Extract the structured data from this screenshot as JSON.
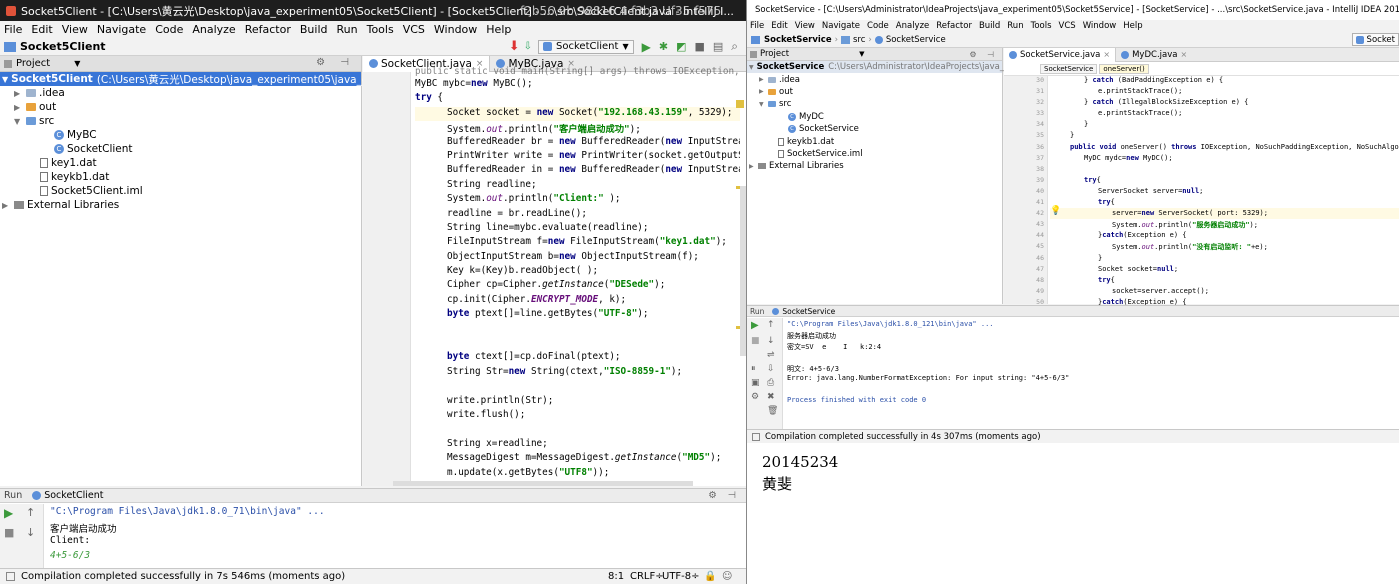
{
  "left": {
    "title": "Socket5Client - [C:\\Users\\黄云光\\Desktop\\java_experiment05\\Socket5Client] - [Socket5Client] - ...\\src\\SocketClient.java - IntelliJ I...",
    "menu": [
      "File",
      "Edit",
      "View",
      "Navigate",
      "Code",
      "Analyze",
      "Refactor",
      "Build",
      "Run",
      "Tools",
      "VCS",
      "Window",
      "Help"
    ],
    "breadcrumb": "Socket5Client",
    "run_config": "SocketClient",
    "overlay_text": "f2b56 9b 98816 4 f3b3 Uf35 f575",
    "project_panel": "Project",
    "tree": [
      {
        "label": "Socket5Client",
        "path": "(C:\\Users\\黄云光\\Desktop\\java_experiment05\\java_experiment",
        "icon": "module"
      },
      {
        "label": ".idea",
        "icon": "folder"
      },
      {
        "label": "out",
        "icon": "folder-orange"
      },
      {
        "label": "src",
        "icon": "folder-blue"
      },
      {
        "label": "MyBC",
        "icon": "class"
      },
      {
        "label": "SocketClient",
        "icon": "class"
      },
      {
        "label": "key1.dat",
        "icon": "file"
      },
      {
        "label": "keykb1.dat",
        "icon": "file"
      },
      {
        "label": "Socket5Client.iml",
        "icon": "file"
      },
      {
        "label": "External Libraries",
        "icon": "lib"
      }
    ],
    "tabs": [
      "SocketClient.java",
      "MyBC.java"
    ],
    "code_top": "public static void main(String[] args) throws IOException, ClassNot",
    "code": [
      "MyBC mybc=new MyBC();",
      "try {",
      "Socket socket = new Socket(\"192.168.43.159\", 5329);",
      "System.out.println(\"客户端启动成功\");",
      "BufferedReader br = new BufferedReader(new InputStreamReader(Sys",
      "PrintWriter write = new PrintWriter(socket.getOutputStream());",
      "BufferedReader in = new BufferedReader(new InputStreamReader(soc",
      "String readline;",
      "System.out.println(\"Client:\" );",
      "readline = br.readLine();",
      "String line=mybc.evaluate(readline);",
      "FileInputStream f=new FileInputStream(\"key1.dat\");",
      "ObjectInputStream b=new ObjectInputStream(f);",
      "Key k=(Key)b.readObject( );",
      "Cipher cp=Cipher.getInstance(\"DESede\");",
      "cp.init(Cipher.ENCRYPT_MODE, k);",
      "byte ptext[]=line.getBytes(\"UTF-8\");",
      "",
      "",
      "byte ctext[]=cp.doFinal(ptext);",
      "String Str=new String(ctext,\"ISO-8859-1\");",
      "",
      "write.println(Str);",
      "write.flush();",
      "",
      "String x=readline;",
      "MessageDigest m=MessageDigest.getInstance(\"MD5\");",
      "m.update(x.getBytes(\"UTF8\"));"
    ],
    "run_label": "Run",
    "run_tab": "SocketClient",
    "console": [
      "\"C:\\Program Files\\Java\\jdk1.8.0_71\\bin\\java\" ...",
      "客户端启动成功",
      "Client:",
      "4+5-6/3"
    ],
    "status": "Compilation completed successfully in 7s 546ms (moments ago)",
    "status_pos": "8:1",
    "status_crlf": "CRLF÷",
    "status_enc": "UTF-8÷"
  },
  "right": {
    "title": "SocketService - [C:\\Users\\Administrator\\IdeaProjects\\java_experiment05\\Socket5Service] - [SocketService] - ...\\src\\SocketService.java - IntelliJ IDEA 2017.1",
    "menu": [
      "File",
      "Edit",
      "View",
      "Navigate",
      "Code",
      "Analyze",
      "Refactor",
      "Build",
      "Run",
      "Tools",
      "VCS",
      "Window",
      "Help"
    ],
    "breadcrumb": [
      "SocketService",
      "src",
      "SocketService"
    ],
    "run_config": "Socket",
    "project_panel": "Project",
    "tree": [
      {
        "label": "SocketService",
        "path": "C:\\Users\\Administrator\\IdeaProjects\\java_experiment",
        "icon": "module"
      },
      {
        "label": ".idea",
        "icon": "folder"
      },
      {
        "label": "out",
        "icon": "folder-orange"
      },
      {
        "label": "src",
        "icon": "folder-blue"
      },
      {
        "label": "MyDC",
        "icon": "class"
      },
      {
        "label": "SocketService",
        "icon": "class"
      },
      {
        "label": "keykb1.dat",
        "icon": "file"
      },
      {
        "label": "SocketService.iml",
        "icon": "file"
      },
      {
        "label": "External Libraries",
        "icon": "lib"
      }
    ],
    "tabs": [
      "SocketService.java",
      "MyDC.java"
    ],
    "crumbs": [
      "SocketService",
      "oneServer()"
    ],
    "line_numbers": [
      "30",
      "31",
      "32",
      "33",
      "34",
      "35",
      "36",
      "37",
      "38",
      "39",
      "40",
      "41",
      "42",
      "43",
      "44",
      "45",
      "46",
      "47",
      "48",
      "49",
      "50"
    ],
    "code": [
      "} catch (BadPaddingException e) {",
      "e.printStackTrace();",
      "} catch (IllegalBlockSizeException e) {",
      "e.printStackTrace();",
      "}",
      "}",
      "public void oneServer() throws IOException, NoSuchPaddingException, NoSuchAlgorithmException, I",
      "MyDC mydc=new MyDC();",
      "",
      "try{",
      "ServerSocket server=null;",
      "try{",
      "server=new ServerSocket( port: 5329);",
      "System.out.println(\"服务器启动成功\");",
      "}catch(Exception e) {",
      "System.out.println(\"没有启动监听: \"+e);",
      "}",
      "Socket socket=null;",
      "try{",
      "socket=server.accept();",
      "}catch(Exception e) {"
    ],
    "run_label": "Run",
    "run_tab": "SocketService",
    "console": [
      "\"C:\\Program Files\\Java\\jdk1.8.0_121\\bin\\java\" ...",
      "服务器启动成功",
      "密文=SV  e    I   k:2:4",
      "",
      "明文: 4+5-6/3",
      "Error: java.lang.NumberFormatException: For input string: \"4+5-6/3\"",
      "",
      "Process finished with exit code 0"
    ],
    "status": "Compilation completed successfully in 4s 307ms (moments ago)"
  },
  "note": {
    "id": "20145234",
    "name": "黄斐"
  },
  "colors": {
    "accent": "#2f65ca",
    "run_green": "#3c9a3c",
    "string_green": "#008000",
    "keyword_navy": "#000080",
    "folder_orange": "#e8a23b",
    "folder_blue": "#6b9bd8",
    "selection": "#3875d7"
  }
}
